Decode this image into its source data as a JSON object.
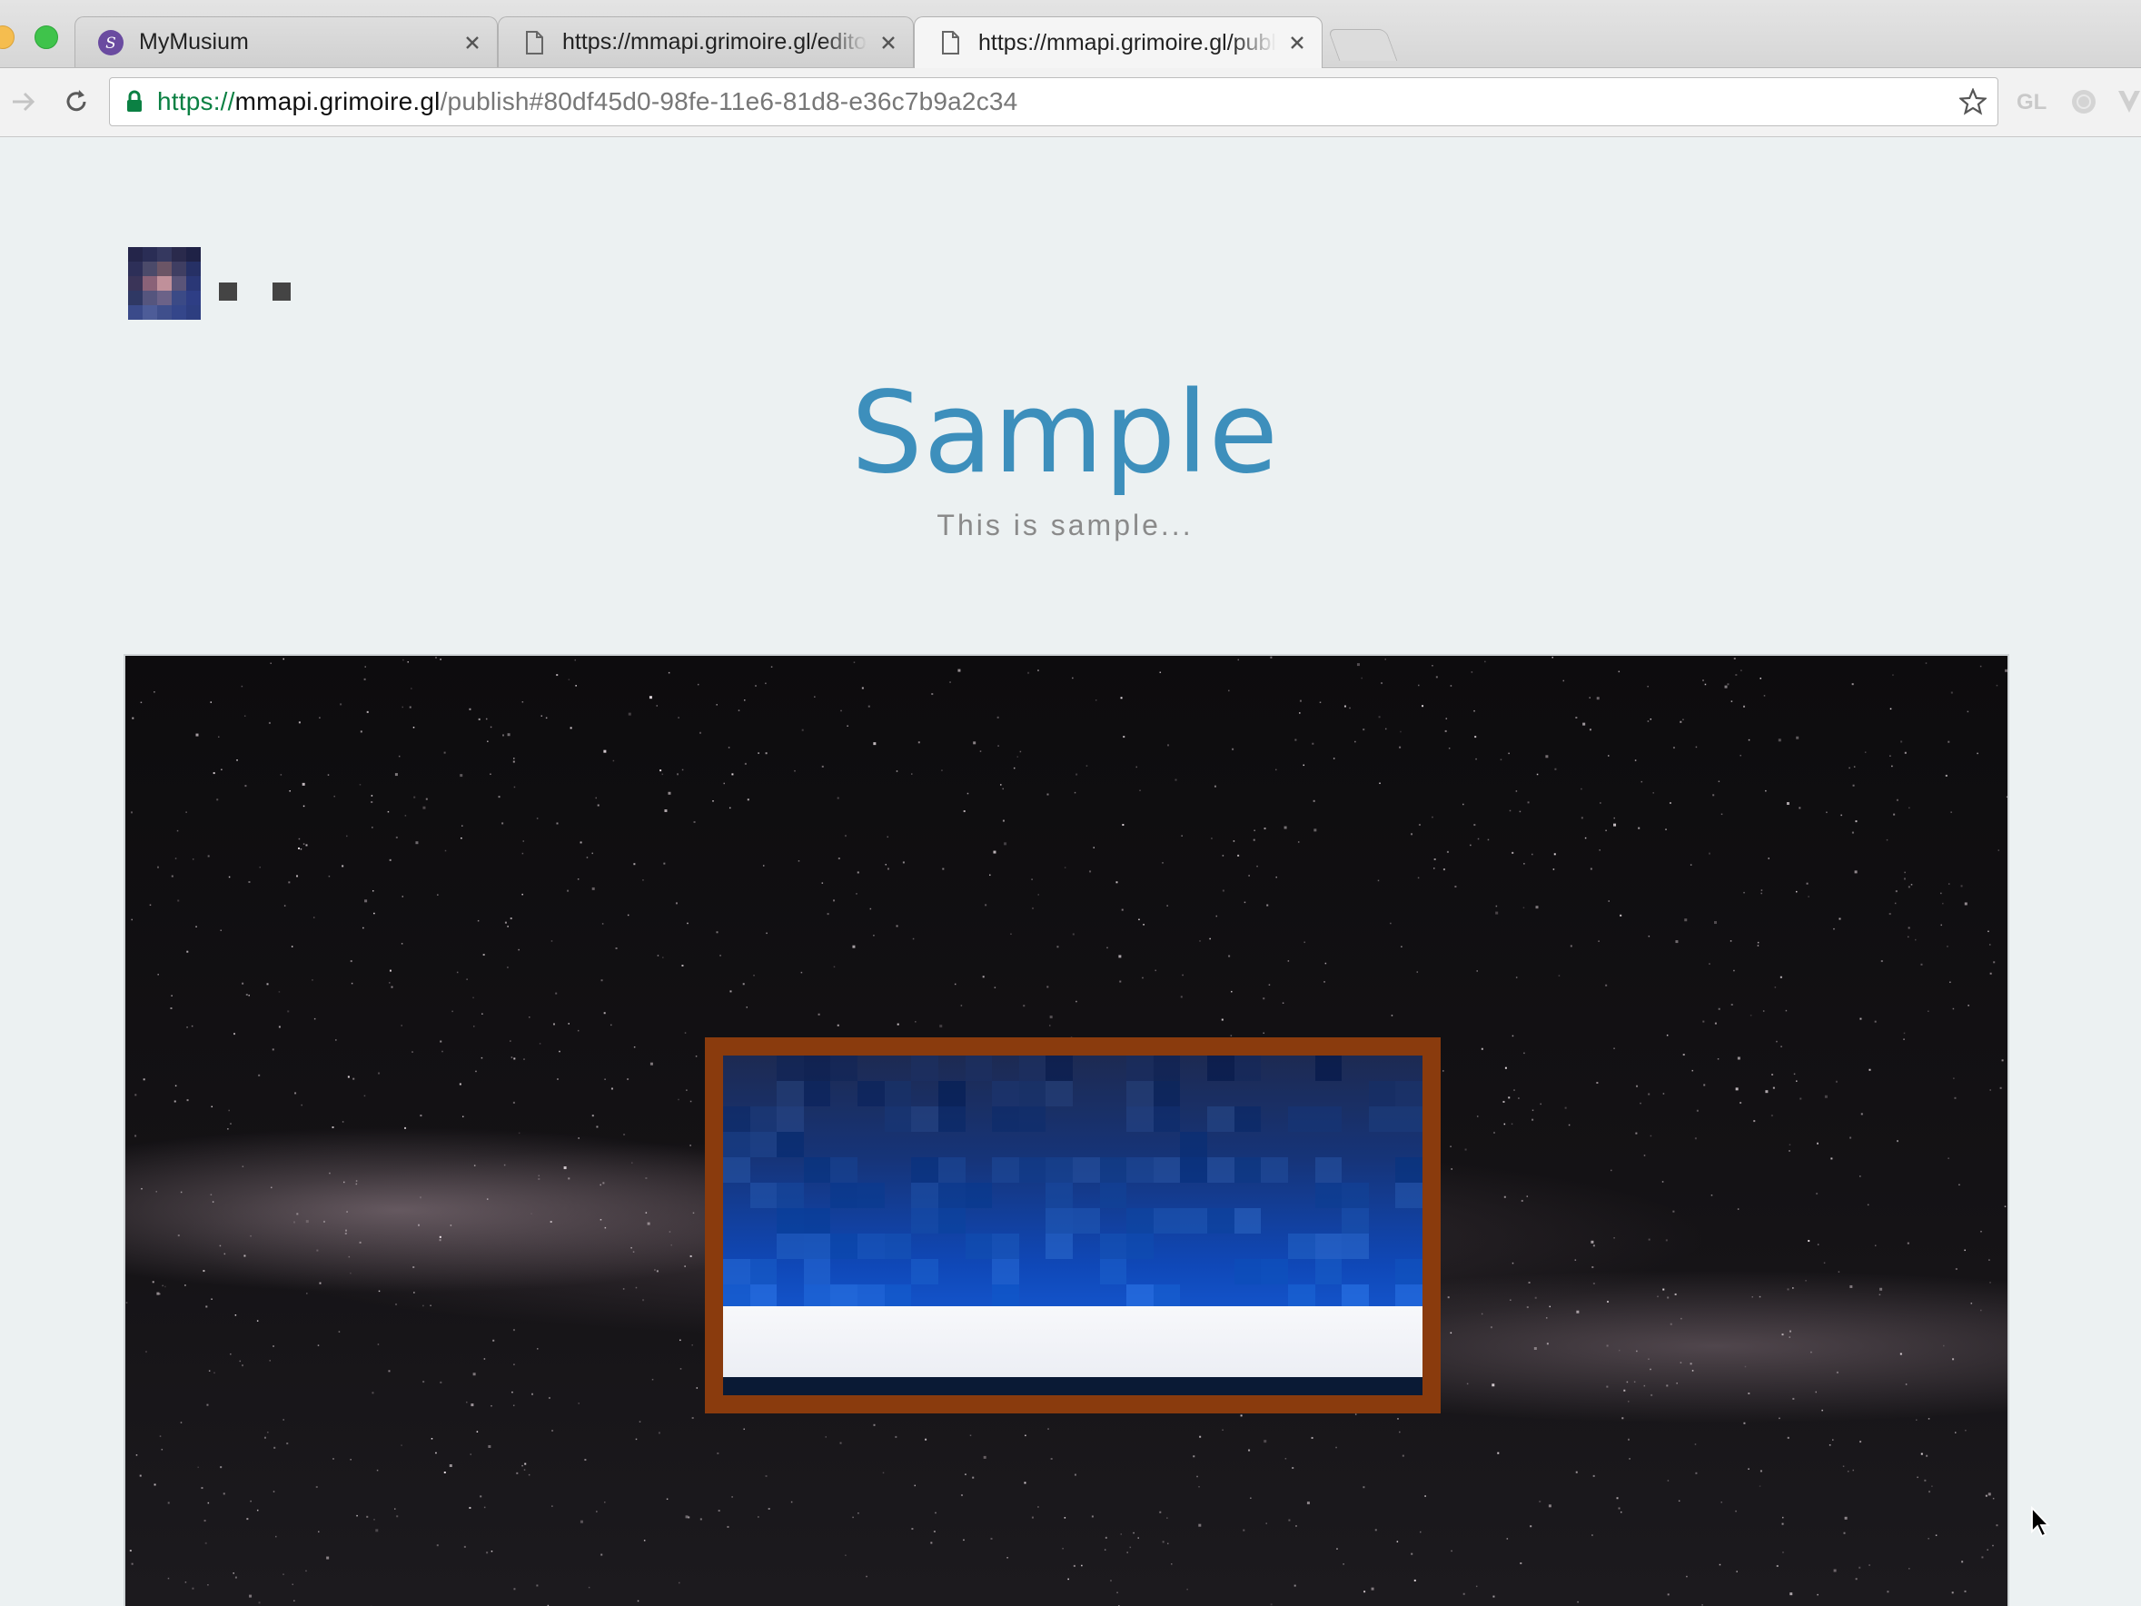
{
  "browser": {
    "tabs": [
      {
        "label": "MyMusium",
        "active": false,
        "icon": "app-s-icon"
      },
      {
        "label": "https://mmapi.grimoire.gl/editor",
        "active": false,
        "icon": "page-icon"
      },
      {
        "label": "https://mmapi.grimoire.gl/publish",
        "active": true,
        "icon": "page-icon"
      }
    ],
    "url": {
      "scheme": "https://",
      "host": "mmapi.grimoire.gl",
      "path": "/publish#80df45d0-98fe-11e6-81d8-e36c7b9a2c34"
    },
    "extensions": {
      "gl_label": "GL"
    }
  },
  "page": {
    "title": "Sample",
    "subtitle": "This is sample..."
  },
  "colors": {
    "page_bg": "#ecf1f2",
    "title": "#3d8fbc",
    "subtitle": "#8a8a8a",
    "frame": "#8a3b0d",
    "secure_green": "#0b8043"
  }
}
